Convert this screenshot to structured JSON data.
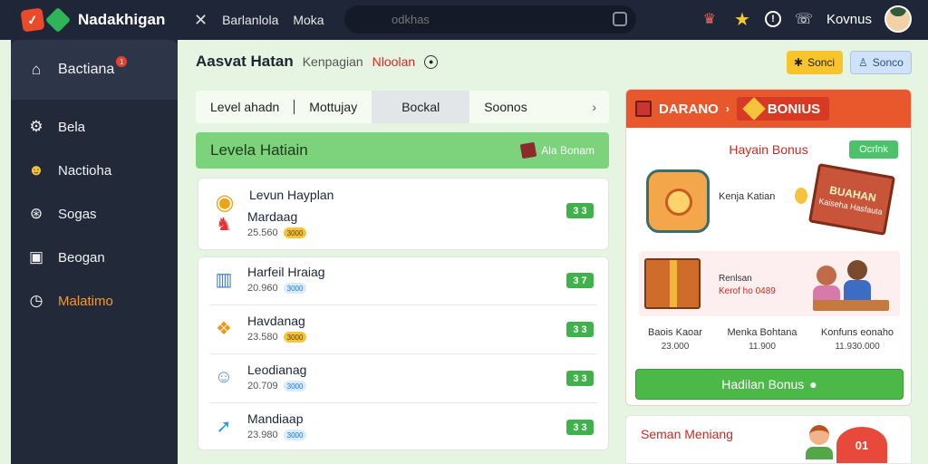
{
  "app": {
    "name": "Nadakhigan"
  },
  "topnav": {
    "items": [
      "Barlanlola",
      "Moka"
    ]
  },
  "search": {
    "placeholder": "odkhas"
  },
  "user": {
    "name": "Kovnus"
  },
  "sidebar": {
    "items": [
      {
        "label": "Bactiana",
        "icon": "home-icon",
        "badge": "1"
      },
      {
        "label": "Bela",
        "icon": "gear-icon"
      },
      {
        "label": "Nactioha",
        "icon": "emoji-icon"
      },
      {
        "label": "Sogas",
        "icon": "compass-icon"
      },
      {
        "label": "Beogan",
        "icon": "bag-icon"
      },
      {
        "label": "Malatimo",
        "icon": "clock-icon"
      }
    ]
  },
  "header": {
    "title": "Aasvat Hatan",
    "crumb1": "Kenpagian",
    "crumb2": "Nloolan",
    "btn_yellow": "Sonci",
    "btn_blue": "Sonco"
  },
  "tabs": [
    "Level ahadn",
    "Mottujay",
    "Bockal",
    "Soonos"
  ],
  "section": {
    "title": "Levela Hatiain",
    "action": "Ala Bonam"
  },
  "list": [
    {
      "title": "Levun Hayplan",
      "sub_title": "Mardaag",
      "value": "25.560",
      "tag": "3000",
      "tag_type": "gold",
      "pill": "3 3"
    },
    {
      "title": "Harfeil Hraiag",
      "value": "20.960",
      "tag": "3000",
      "tag_type": "blue",
      "pill": "3 7"
    },
    {
      "title": "Havdanag",
      "value": "23.580",
      "tag": "3000",
      "tag_type": "gold",
      "pill": "3 3"
    },
    {
      "title": "Leodianag",
      "value": "20.709",
      "tag": "3000",
      "tag_type": "blue",
      "pill": "3 3"
    },
    {
      "title": "Mandiaap",
      "value": "23.980",
      "tag": "3000",
      "tag_type": "blue",
      "pill": "3 3"
    }
  ],
  "bonus_panel": {
    "head_left": "DARANO",
    "head_right": "BONIUS",
    "title": "Hayain Bonus",
    "chip": "Ocrlnk",
    "feature_text": "Kenja Katian",
    "sign_title": "BUAHAN",
    "sign_sub": "Kaiseha Hasfauta",
    "banner_line1": "Renlsan",
    "banner_line2": "Kerof ho 0489",
    "stats": [
      {
        "label": "Baois Kaoar",
        "value": "23.000"
      },
      {
        "label": "Menka Bohtana",
        "value": "11.900"
      },
      {
        "label": "Konfuns eonaho",
        "value": "11.930.000"
      }
    ],
    "cta": "Hadilan Bonus"
  },
  "bottom_panel": {
    "title": "Seman Meniang",
    "badge": "01"
  },
  "colors": {
    "topbar": "#1e2637",
    "sidebar": "#222a3a",
    "accent_green": "#4cb847",
    "accent_orange": "#e8582c",
    "page_bg": "#e6f5e1"
  }
}
